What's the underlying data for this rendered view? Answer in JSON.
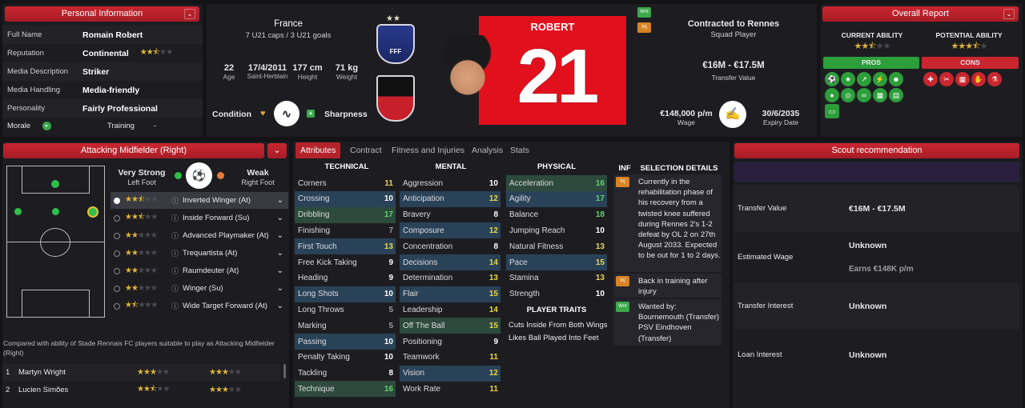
{
  "personal": {
    "header": "Personal Information",
    "rows": [
      {
        "label": "Full Name",
        "value": "Romain Robert"
      },
      {
        "label": "Reputation",
        "value": "Continental"
      },
      {
        "label": "Media Description",
        "value": "Striker"
      },
      {
        "label": "Media Handling",
        "value": "Media-friendly"
      },
      {
        "label": "Personality",
        "value": "Fairly Professional"
      }
    ],
    "morale_label": "Morale",
    "training_label": "Training",
    "training_value": "-",
    "reputation_stars": 2.5
  },
  "nation": {
    "name": "France",
    "caps": "7 U21 caps / 3 U21 goals"
  },
  "bio": {
    "age": "22",
    "age_label": "Age",
    "dob": "17/4/2011",
    "birthplace": "Saint-Herblain",
    "height": "177 cm",
    "height_label": "Height",
    "weight": "71 kg",
    "weight_label": "Weight"
  },
  "condition_label": "Condition",
  "sharpness_label": "Sharpness",
  "player": {
    "surname": "ROBERT",
    "number": "21"
  },
  "contract": {
    "status": "Contracted to Rennes",
    "role": "Squad Player",
    "value": "€16M - €17.5M",
    "value_label": "Transfer Value",
    "wage": "€148,000 p/m",
    "wage_label": "Wage",
    "expiry": "30/6/2035",
    "expiry_label": "Expiry Date",
    "badge_wnt": "Wnt",
    "badge_inj": "Inj"
  },
  "overall": {
    "header": "Overall Report",
    "ca_label": "CURRENT ABILITY",
    "pa_label": "POTENTIAL ABILITY",
    "ca_stars": 2.5,
    "pa_stars": 3.5,
    "pros_label": "PROS",
    "cons_label": "CONS"
  },
  "position": {
    "header": "Attacking Midfielder (Right)",
    "strong_foot_label": "Very Strong",
    "strong_foot": "Left Foot",
    "weak_foot_label": "Weak",
    "weak_foot": "Right Foot",
    "roles": [
      {
        "name": "Inverted Winger (At)",
        "stars": 2.5
      },
      {
        "name": "Inside Forward (Su)",
        "stars": 2.5
      },
      {
        "name": "Advanced Playmaker (At)",
        "stars": 2
      },
      {
        "name": "Trequartista (At)",
        "stars": 2
      },
      {
        "name": "Raumdeuter (At)",
        "stars": 2
      },
      {
        "name": "Winger (Su)",
        "stars": 2
      },
      {
        "name": "Wide Target Forward (At)",
        "stars": 1.5
      }
    ],
    "compare_text": "Compared with ability of Stade Rennais FC players suitable to play as Attacking Midfielder (Right)",
    "compare": [
      {
        "rank": "1",
        "name": "Martyn Wright",
        "s1": 3,
        "s2": 3
      },
      {
        "rank": "2",
        "name": "Lucien Simões",
        "s1": 2.5,
        "s2": 3
      }
    ]
  },
  "tabs": [
    "Attributes",
    "Contract",
    "Fitness and Injuries",
    "Analysis",
    "Stats"
  ],
  "attributes": {
    "technical_label": "TECHNICAL",
    "mental_label": "MENTAL",
    "physical_label": "PHYSICAL",
    "inf_label": "INF",
    "selection_label": "SELECTION DETAILS",
    "traits_label": "PLAYER TRAITS",
    "technical": [
      [
        "Corners",
        "11"
      ],
      [
        "Crossing",
        "10"
      ],
      [
        "Dribbling",
        "17"
      ],
      [
        "Finishing",
        "7"
      ],
      [
        "First Touch",
        "13"
      ],
      [
        "Free Kick Taking",
        "9"
      ],
      [
        "Heading",
        "9"
      ],
      [
        "Long Shots",
        "10"
      ],
      [
        "Long Throws",
        "5"
      ],
      [
        "Marking",
        "5"
      ],
      [
        "Passing",
        "10"
      ],
      [
        "Penalty Taking",
        "10"
      ],
      [
        "Tackling",
        "8"
      ],
      [
        "Technique",
        "16"
      ]
    ],
    "mental": [
      [
        "Aggression",
        "10"
      ],
      [
        "Anticipation",
        "12"
      ],
      [
        "Bravery",
        "8"
      ],
      [
        "Composure",
        "12"
      ],
      [
        "Concentration",
        "8"
      ],
      [
        "Decisions",
        "14"
      ],
      [
        "Determination",
        "13"
      ],
      [
        "Flair",
        "15"
      ],
      [
        "Leadership",
        "14"
      ],
      [
        "Off The Ball",
        "15"
      ],
      [
        "Positioning",
        "9"
      ],
      [
        "Teamwork",
        "11"
      ],
      [
        "Vision",
        "12"
      ],
      [
        "Work Rate",
        "11"
      ]
    ],
    "physical": [
      [
        "Acceleration",
        "16"
      ],
      [
        "Agility",
        "17"
      ],
      [
        "Balance",
        "18"
      ],
      [
        "Jumping Reach",
        "10"
      ],
      [
        "Natural Fitness",
        "13"
      ],
      [
        "Pace",
        "15"
      ],
      [
        "Stamina",
        "13"
      ],
      [
        "Strength",
        "10"
      ]
    ],
    "traits": [
      "Cuts Inside From Both Wings",
      "Likes Ball Played Into Feet"
    ],
    "selection": [
      "Currently in the rehabilitation phase of his recovery from a twisted knee suffered during Rennes 2's 1-2 defeat by OL 2 on 27th August 2033. Expected to be out for 1 to 2 days.",
      "Back in training after injury",
      "Wanted by: Bournemouth (Transfer) PSV Eindhoven (Transfer)"
    ]
  },
  "scout": {
    "header": "Scout recommendation",
    "rows": [
      {
        "label": "Transfer Value",
        "value": "€16M - €17.5M"
      },
      {
        "label": "Estimated Wage",
        "value": "Unknown",
        "sub": "Earns €148K p/m"
      },
      {
        "label": "Transfer Interest",
        "value": "Unknown"
      },
      {
        "label": "Loan Interest",
        "value": "Unknown"
      }
    ]
  },
  "colors": {
    "accent": "#b5222b",
    "positive": "#5fd46a",
    "highlight": "#e8d84a"
  }
}
